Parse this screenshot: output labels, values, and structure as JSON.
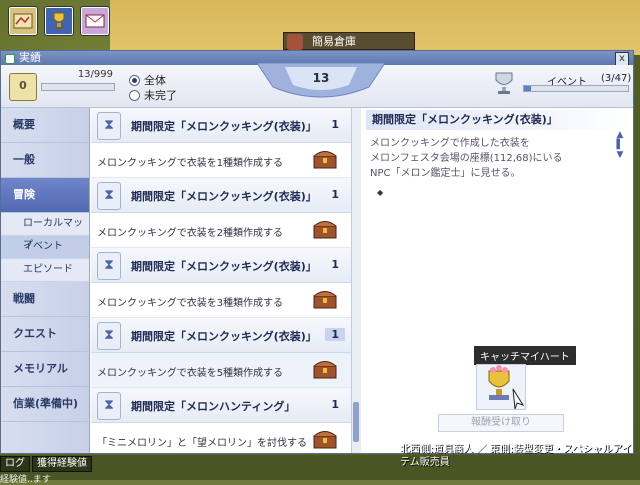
{
  "npc_label": "簡易倉庫",
  "window": {
    "title": "実績",
    "close": "x"
  },
  "summary": {
    "total_count": "13/999",
    "filter_all": "全体",
    "filter_incomplete": "未完了",
    "points": "13",
    "event_label": "イベント",
    "event_count": "(3/47)",
    "event_progress": 0.064
  },
  "sidebar": {
    "items": [
      {
        "label": "概要"
      },
      {
        "label": "一般"
      },
      {
        "label": "冒険"
      },
      {
        "label": "戦闘"
      },
      {
        "label": "クエスト"
      },
      {
        "label": "メモリアル"
      },
      {
        "label": "信業(準備中)"
      }
    ],
    "sub_items": [
      {
        "label": "ローカルマップ"
      },
      {
        "label": "イベント"
      },
      {
        "label": "エピソード"
      }
    ]
  },
  "list": [
    {
      "title": "期間限定「メロンクッキング(衣装)」",
      "count": "1",
      "desc": "メロンクッキングで衣装を1種類作成する"
    },
    {
      "title": "期間限定「メロンクッキング(衣装)」",
      "count": "1",
      "desc": "メロンクッキングで衣装を2種類作成する"
    },
    {
      "title": "期間限定「メロンクッキング(衣装)」",
      "count": "1",
      "desc": "メロンクッキングで衣装を3種類作成する"
    },
    {
      "title": "期間限定「メロンクッキング(衣装)」",
      "count": "1",
      "desc": "メロンクッキングで衣装を5種類作成する"
    },
    {
      "title": "期間限定「メロンハンティング」",
      "count": "1",
      "desc": "「ミニメロリン」と「望メロリン」を討伐する"
    }
  ],
  "detail": {
    "title": "期間限定「メロンクッキング(衣装)」",
    "line1": "メロンクッキングで作成した衣装を",
    "line2": "メロンフェスタ会場の座標(112,68)にいる",
    "line3": "NPC「メロン鑑定士」に見せる。",
    "bullet": "◆",
    "reward_label": "キャッチマイハート",
    "claim_button": "報酬受け取り"
  },
  "bottom": {
    "tab1": "ログ",
    "tab2": "獲得経験値",
    "message": "北西側:道具商人 ／ 東側:装型変更・スペシャルアイテム販売員",
    "partial": "経験値..ます"
  }
}
